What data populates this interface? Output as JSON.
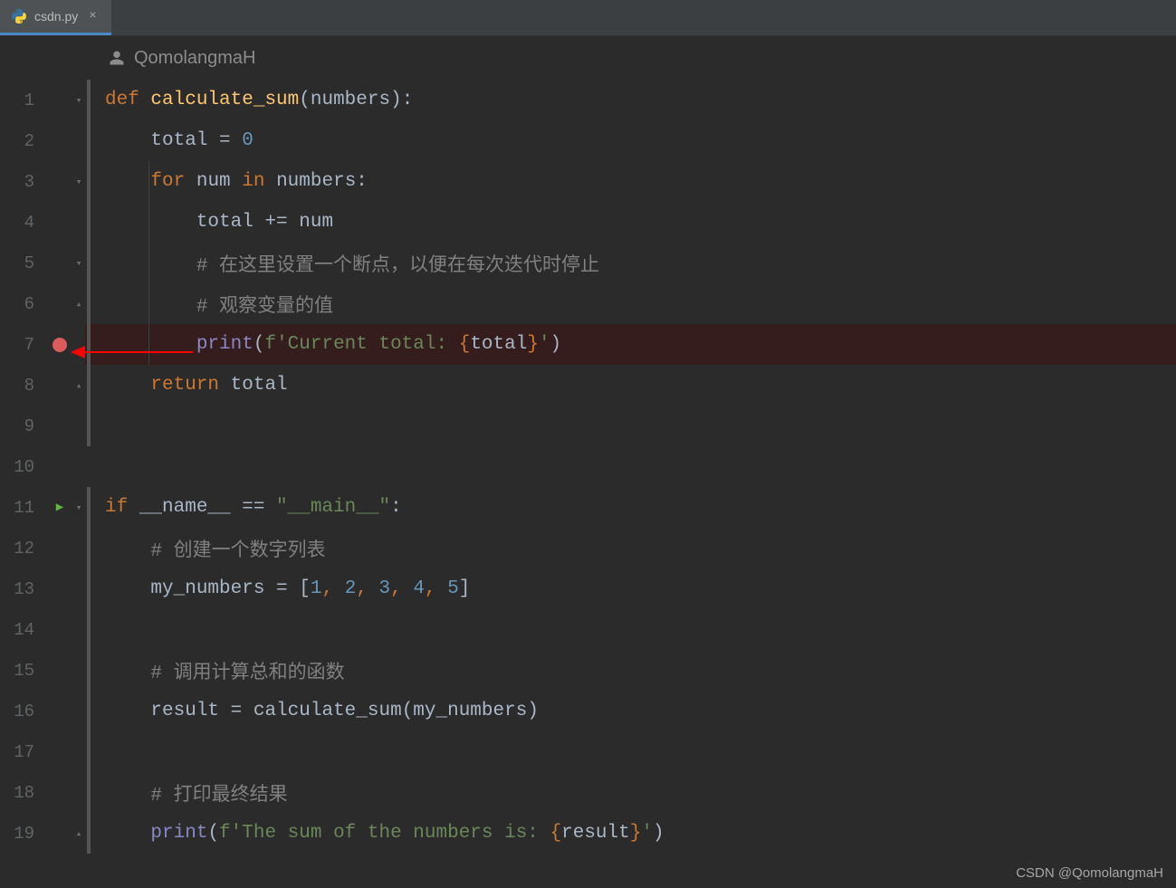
{
  "tab": {
    "filename": "csdn.py",
    "close_glyph": "×"
  },
  "author": {
    "name": "QomolangmaH"
  },
  "watermark": "CSDN @QomolangmaH",
  "gutter": {
    "breakpoint_line": 7,
    "run_line": 11,
    "line_numbers": [
      "1",
      "2",
      "3",
      "4",
      "5",
      "6",
      "7",
      "8",
      "9",
      "10",
      "11",
      "12",
      "13",
      "14",
      "15",
      "16",
      "17",
      "18",
      "19"
    ]
  },
  "code": {
    "l1": {
      "def": "def ",
      "fn": "calculate_sum",
      "lp": "(",
      "arg": "numbers",
      "rp": ")",
      "colon": ":"
    },
    "l2": {
      "indent": "    ",
      "var": "total ",
      "eq": "= ",
      "zero": "0"
    },
    "l3": {
      "indent": "    ",
      "for": "for ",
      "var": "num ",
      "in": "in ",
      "iter": "numbers",
      "colon": ":"
    },
    "l4": {
      "indent": "        ",
      "var": "total ",
      "op": "+= ",
      "rhs": "num"
    },
    "l5": {
      "indent": "        ",
      "comment": "# 在这里设置一个断点，以便在每次迭代时停止"
    },
    "l6": {
      "indent": "        ",
      "comment": "# 观察变量的值"
    },
    "l7": {
      "indent": "        ",
      "print": "print",
      "lp": "(",
      "f": "f",
      "s1": "'Current total: ",
      "lb": "{",
      "expr": "total",
      "rb": "}",
      "s2": "'",
      "rp": ")"
    },
    "l8": {
      "indent": "    ",
      "return": "return ",
      "var": "total"
    },
    "l11": {
      "if": "if ",
      "name": "__name__ ",
      "eq": "== ",
      "main": "\"__main__\"",
      "colon": ":"
    },
    "l12": {
      "indent": "    ",
      "comment": "# 创建一个数字列表"
    },
    "l13": {
      "indent": "    ",
      "var": "my_numbers ",
      "eq": "= ",
      "lb": "[",
      "n1": "1",
      "c": ", ",
      "n2": "2",
      "n3": "3",
      "n4": "4",
      "n5": "5",
      "rb": "]"
    },
    "l15": {
      "indent": "    ",
      "comment": "# 调用计算总和的函数"
    },
    "l16": {
      "indent": "    ",
      "var": "result ",
      "eq": "= ",
      "fn": "calculate_sum",
      "lp": "(",
      "arg": "my_numbers",
      "rp": ")"
    },
    "l18": {
      "indent": "    ",
      "comment": "# 打印最终结果"
    },
    "l19": {
      "indent": "    ",
      "print": "print",
      "lp": "(",
      "f": "f",
      "s1": "'The sum of the numbers is: ",
      "lb": "{",
      "expr": "result",
      "rb": "}",
      "s2": "'",
      "rp": ")"
    }
  }
}
